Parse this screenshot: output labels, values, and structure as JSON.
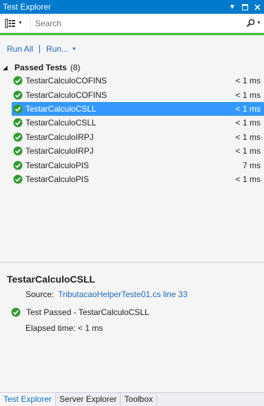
{
  "window": {
    "title": "Test Explorer"
  },
  "toolbar": {
    "group_by_icon": "group-by-icon",
    "search_placeholder": "Search",
    "search_icon": "search-icon"
  },
  "status_color": "#3ec43a",
  "actions": {
    "run_all": "Run All",
    "run": "Run..."
  },
  "group": {
    "name": "Passed Tests",
    "count": "(8)"
  },
  "tests": [
    {
      "name": "TestarCalculoCOFINS",
      "duration": "< 1 ms"
    },
    {
      "name": "TestarCalculoCOFINS",
      "duration": "< 1 ms"
    },
    {
      "name": "TestarCalculoCSLL",
      "duration": "< 1 ms"
    },
    {
      "name": "TestarCalculoCSLL",
      "duration": "< 1 ms"
    },
    {
      "name": "TestarCalculoIRPJ",
      "duration": "< 1 ms"
    },
    {
      "name": "TestarCalculoIRPJ",
      "duration": "< 1 ms"
    },
    {
      "name": "TestarCalculoPIS",
      "duration": "7 ms"
    },
    {
      "name": "TestarCalculoPIS",
      "duration": "< 1 ms"
    }
  ],
  "selected_index": 2,
  "details": {
    "title": "TestarCalculoCSLL",
    "source_label": "Source:",
    "source_link": "TributacaoHelperTeste01.cs line 33",
    "result": "Test Passed - TestarCalculoCSLL",
    "elapsed": "Elapsed time: < 1 ms"
  },
  "bottom_tabs": [
    "Test Explorer",
    "Server Explorer",
    "Toolbox"
  ]
}
